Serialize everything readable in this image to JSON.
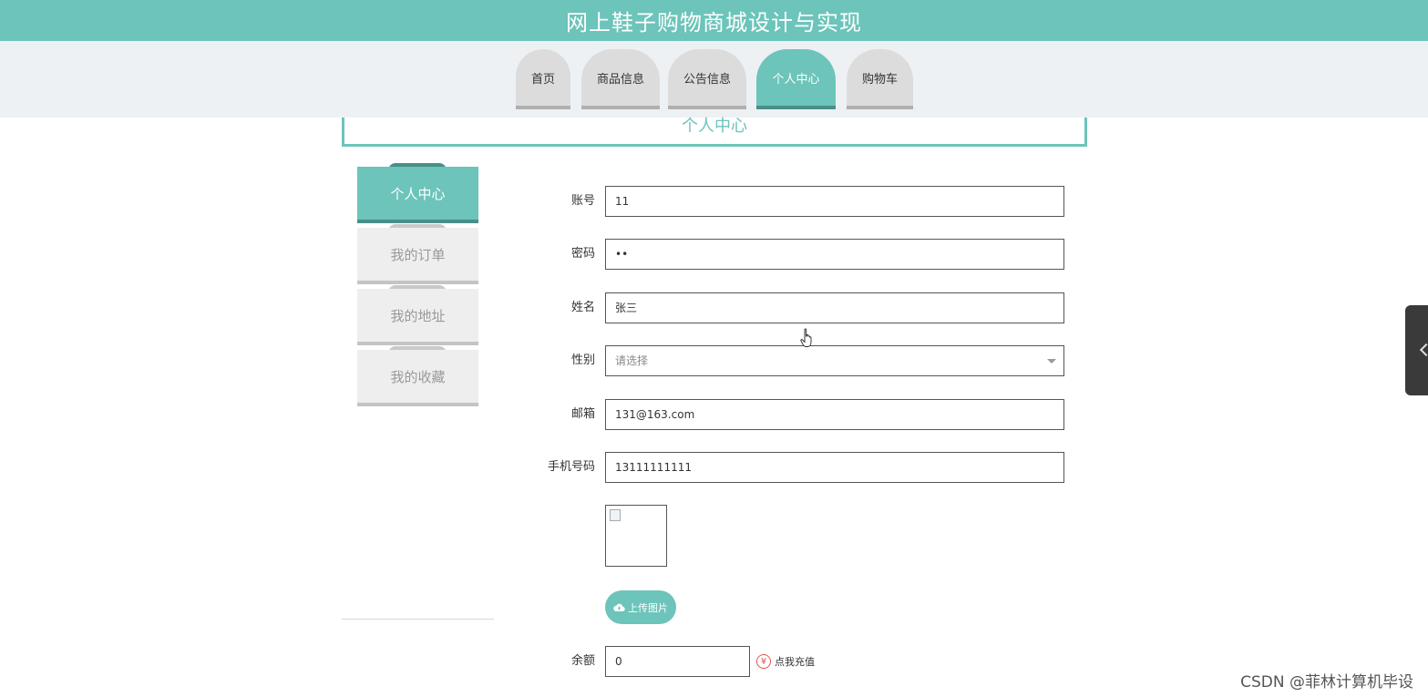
{
  "header": {
    "title": "网上鞋子购物商城设计与实现"
  },
  "nav": {
    "tabs": [
      {
        "label": "首页",
        "active": false
      },
      {
        "label": "商品信息",
        "active": false
      },
      {
        "label": "公告信息",
        "active": false
      },
      {
        "label": "个人中心",
        "active": true
      },
      {
        "label": "购物车",
        "active": false
      }
    ]
  },
  "section": {
    "title": "个人中心"
  },
  "sidebar": {
    "items": [
      {
        "label": "个人中心",
        "active": true
      },
      {
        "label": "我的订单",
        "active": false
      },
      {
        "label": "我的地址",
        "active": false
      },
      {
        "label": "我的收藏",
        "active": false
      }
    ]
  },
  "form": {
    "account": {
      "label": "账号",
      "value": "11"
    },
    "password": {
      "label": "密码",
      "value": "••"
    },
    "name": {
      "label": "姓名",
      "value": "张三"
    },
    "gender": {
      "label": "性别",
      "placeholder": "请选择"
    },
    "email": {
      "label": "邮箱",
      "value": "131@163.com"
    },
    "phone": {
      "label": "手机号码",
      "value": "13111111111"
    },
    "upload_label": "上传图片",
    "balance": {
      "label": "余额",
      "value": "0"
    },
    "recharge_label": "点我充值"
  },
  "icons": {
    "upload": "cloud-upload-icon",
    "recharge": "yen-icon",
    "cursor": "hand-pointer-icon"
  },
  "watermark": "CSDN @菲林计算机毕设",
  "colors": {
    "accent": "#6cc4ba",
    "accent_dark": "#4a8f89",
    "nav_bg": "#edf1f3"
  }
}
